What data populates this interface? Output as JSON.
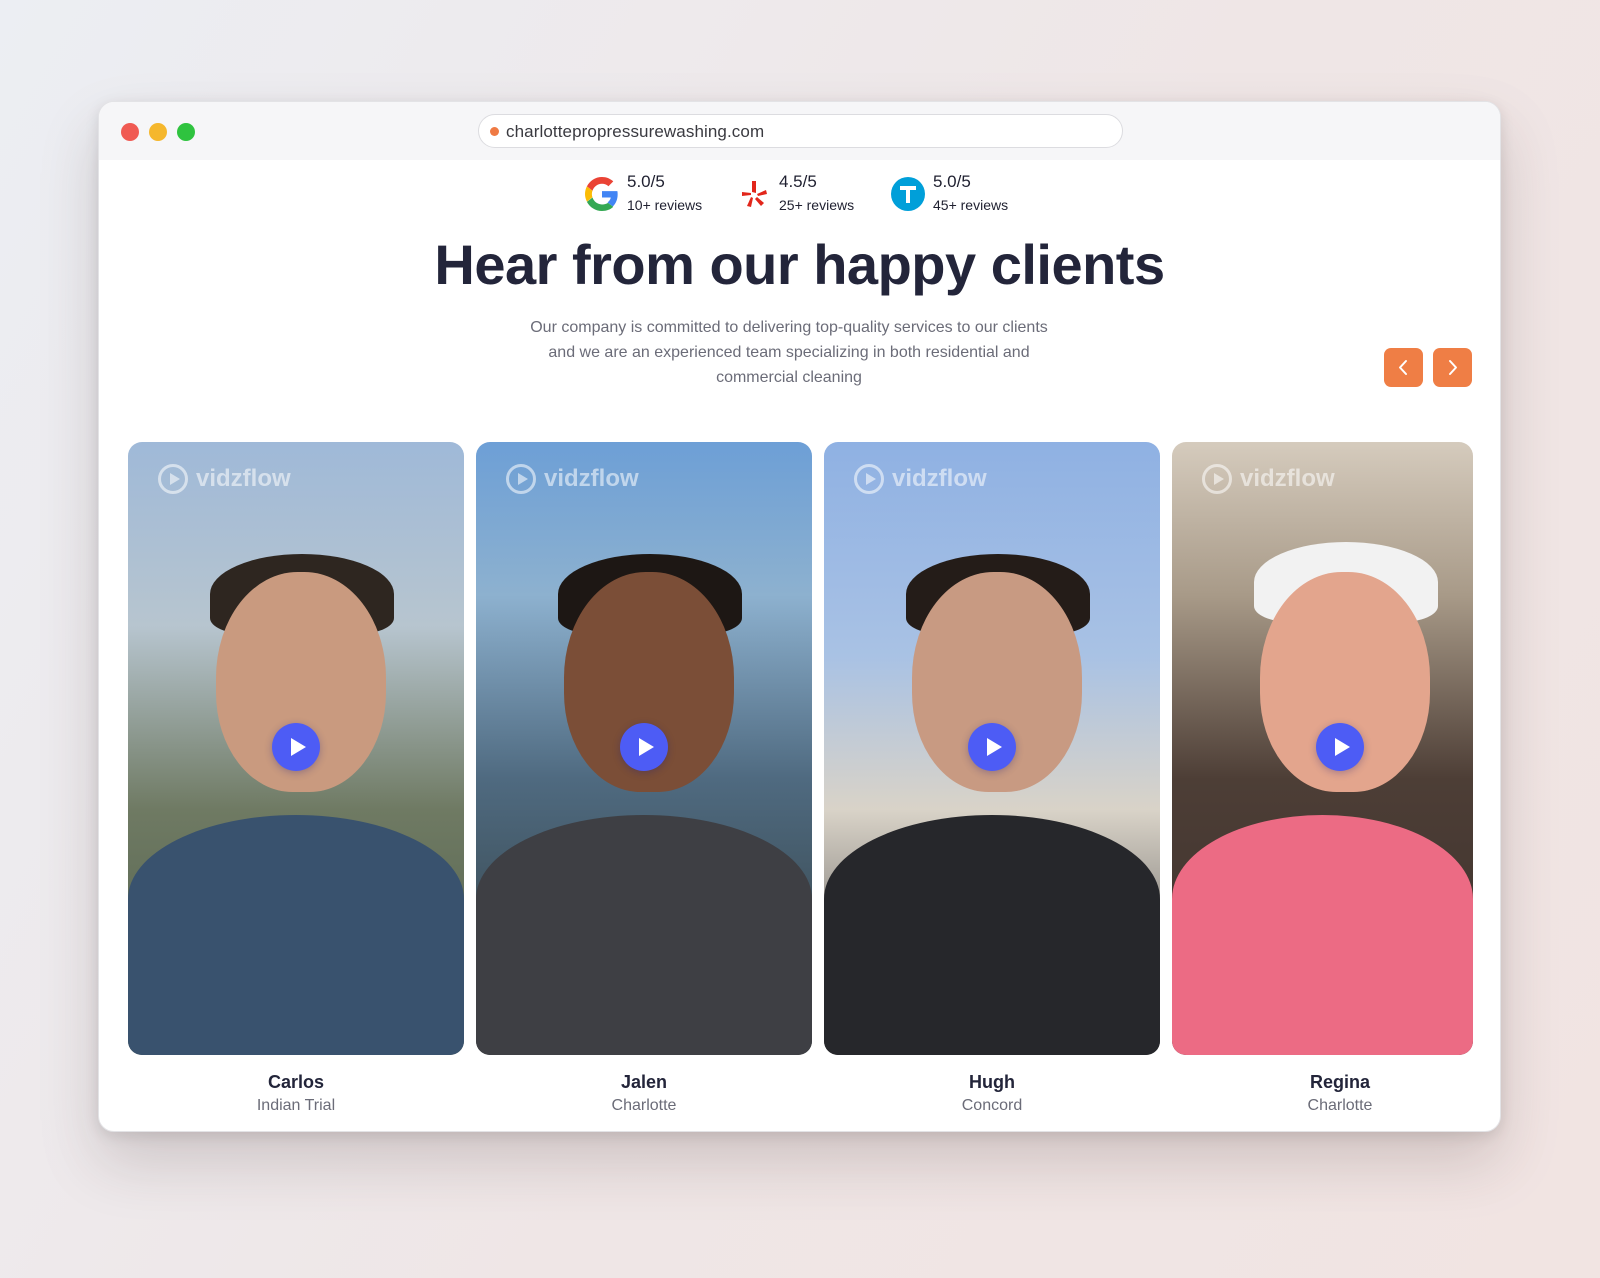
{
  "browser": {
    "url": "charlottepropressurewashing.com"
  },
  "ratings": [
    {
      "icon": "google-icon",
      "score": "5.0/5",
      "count": "10+ reviews"
    },
    {
      "icon": "yelp-icon",
      "score": "4.5/5",
      "count": "25+ reviews"
    },
    {
      "icon": "thumbtack-icon",
      "score": "5.0/5",
      "count": "45+ reviews"
    }
  ],
  "section": {
    "title": "Hear from our happy clients",
    "subtitle": "Our company is committed to delivering top-quality services to our clients and we are an experienced team specializing in both residential and commercial cleaning"
  },
  "carousel": {
    "prev_icon": "chevron-left-icon",
    "next_icon": "chevron-right-icon",
    "accent_color": "#ef7e45"
  },
  "watermark": "vidzflow",
  "testimonials": [
    {
      "name": "Carlos",
      "city": "Indian Trial"
    },
    {
      "name": "Jalen",
      "city": "Charlotte"
    },
    {
      "name": "Hugh",
      "city": "Concord"
    },
    {
      "name": "Regina",
      "city": "Charlotte"
    }
  ],
  "colors": {
    "play_button": "#4d5cf5",
    "heading": "#23253a"
  }
}
